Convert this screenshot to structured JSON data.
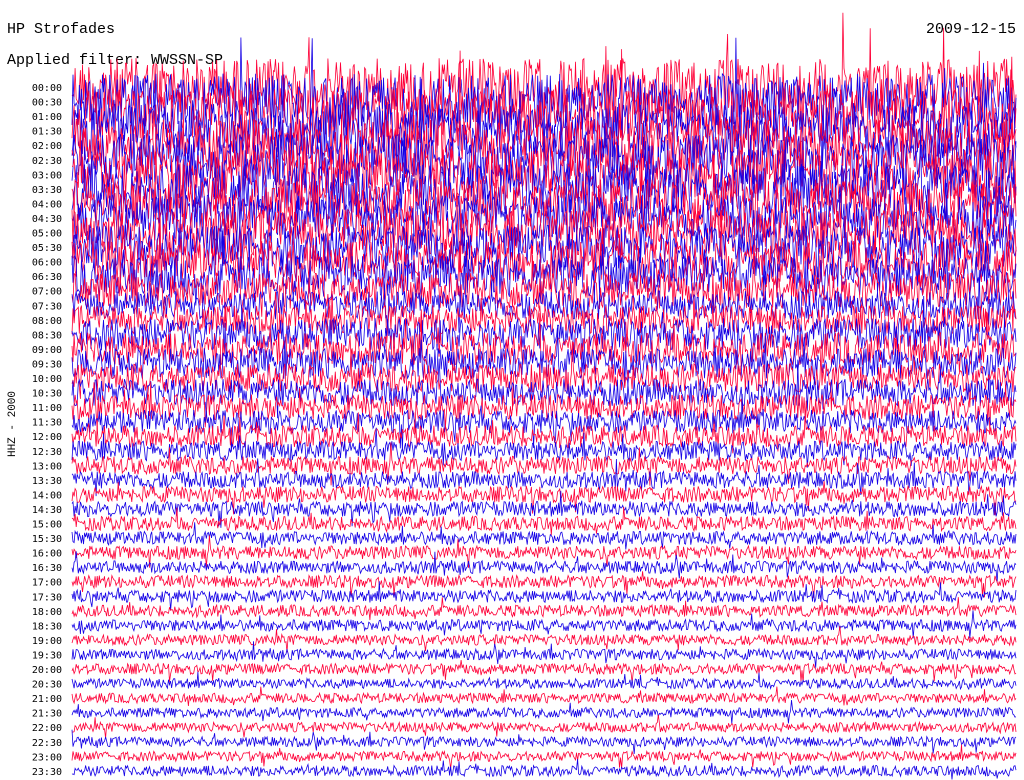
{
  "header": {
    "station": "HP Strofades",
    "date": "2009-12-15",
    "filter": "Applied filter: WWSSN-SP"
  },
  "colors": {
    "trace_a": "#1400e6",
    "trace_b": "#ff0038",
    "background": "#ffffff"
  },
  "chart_data": {
    "type": "line",
    "title": "HP Strofades",
    "subtitle": "Applied filter: WWSSN-SP",
    "date": "2009-12-15",
    "ylabel": "HHZ - 2000",
    "xlabel": "",
    "grid": false,
    "legend": "none",
    "row_labels": [
      "00:00",
      "00:30",
      "01:00",
      "01:30",
      "02:00",
      "02:30",
      "03:00",
      "03:30",
      "04:00",
      "04:30",
      "05:00",
      "05:30",
      "06:00",
      "06:30",
      "07:00",
      "07:30",
      "08:00",
      "08:30",
      "09:00",
      "09:30",
      "10:00",
      "10:30",
      "11:00",
      "11:30",
      "12:00",
      "12:30",
      "13:00",
      "13:30",
      "14:00",
      "14:30",
      "15:00",
      "15:30",
      "16:00",
      "16:30",
      "17:00",
      "17:30",
      "18:00",
      "18:30",
      "19:00",
      "19:30",
      "20:00",
      "20:30",
      "21:00",
      "21:30",
      "22:00",
      "22:30",
      "23:00",
      "23:30"
    ],
    "row_colors": [
      "trace_b",
      "trace_a"
    ],
    "amplitude": [
      3.2,
      3.1,
      3.0,
      3.0,
      2.9,
      2.9,
      2.8,
      2.8,
      2.7,
      2.6,
      2.5,
      2.4,
      2.3,
      2.3,
      2.0,
      1.6,
      1.6,
      1.8,
      1.8,
      1.7,
      1.6,
      1.5,
      1.4,
      1.3,
      1.2,
      1.1,
      1.0,
      0.95,
      0.9,
      0.85,
      0.8,
      0.75,
      0.75,
      0.7,
      0.7,
      0.7,
      0.65,
      0.65,
      0.6,
      0.6,
      0.6,
      0.55,
      0.55,
      0.55,
      0.55,
      0.55,
      0.55,
      0.6
    ]
  }
}
